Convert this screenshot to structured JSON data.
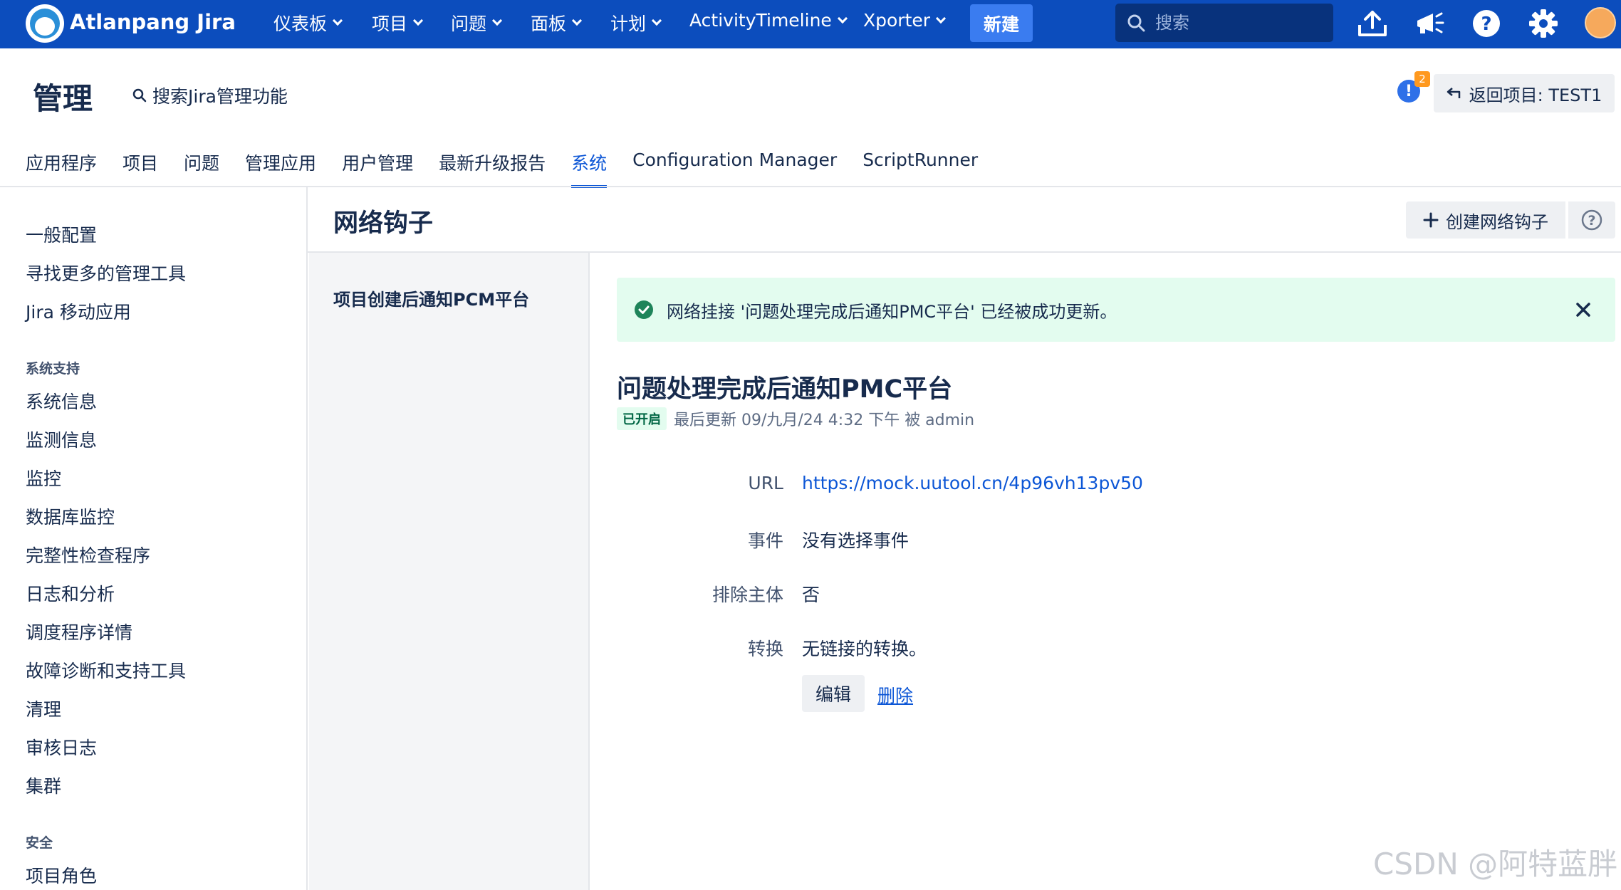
{
  "topnav": {
    "brand": "Atlanpang Jira",
    "items": [
      {
        "label": "仪表板"
      },
      {
        "label": "项目"
      },
      {
        "label": "问题"
      },
      {
        "label": "面板"
      },
      {
        "label": "计划"
      },
      {
        "label": "ActivityTimeline"
      },
      {
        "label": "Xporter"
      }
    ],
    "create_label": "新建",
    "search_placeholder": "搜索",
    "icons": [
      "upload-icon",
      "megaphone-icon",
      "help-icon",
      "gear-icon",
      "avatar"
    ]
  },
  "admin": {
    "title": "管理",
    "search_label": "搜索Jira管理功能",
    "notification_count": "2",
    "return_label": "返回项目: TEST1"
  },
  "tabs": [
    {
      "label": "应用程序"
    },
    {
      "label": "项目"
    },
    {
      "label": "问题"
    },
    {
      "label": "管理应用"
    },
    {
      "label": "用户管理"
    },
    {
      "label": "最新升级报告"
    },
    {
      "label": "系统",
      "active": true
    },
    {
      "label": "Configuration Manager"
    },
    {
      "label": "ScriptRunner"
    }
  ],
  "sidebar": {
    "items_top": [
      "一般配置",
      "寻找更多的管理工具",
      "Jira 移动应用"
    ],
    "section_support": "系统支持",
    "items_support": [
      "系统信息",
      "监测信息",
      "监控",
      "数据库监控",
      "完整性检查程序",
      "日志和分析",
      "调度程序详情",
      "故障诊断和支持工具",
      "清理",
      "审核日志",
      "集群"
    ],
    "section_security": "安全",
    "items_security": [
      "项目角色"
    ]
  },
  "page": {
    "title": "网络钩子",
    "create_button": "创建网络钩子"
  },
  "hook_list": {
    "items": [
      "项目创建后通知PCM平台"
    ]
  },
  "flag": {
    "message": "网络挂接 '问题处理完成后通知PMC平台' 已经被成功更新。"
  },
  "detail": {
    "title": "问题处理完成后通知PMC平台",
    "status": "已开启",
    "meta": "最后更新 09/九月/24 4:32 下午 被 admin",
    "fields": [
      {
        "label": "URL",
        "value": "https://mock.uutool.cn/4p96vh13pv50"
      },
      {
        "label": "事件",
        "value": "没有选择事件"
      },
      {
        "label": "排除主体",
        "value": "否"
      },
      {
        "label": "转换",
        "value": "无链接的转换。"
      }
    ],
    "edit_button": "编辑",
    "delete_link": "删除"
  },
  "watermark": "CSDN @阿特蓝胖",
  "colors": {
    "nav_bg": "#0c4dbd",
    "accent": "#0c56d6",
    "success_bg": "#e3fcef",
    "success_icon": "#1f845a"
  }
}
